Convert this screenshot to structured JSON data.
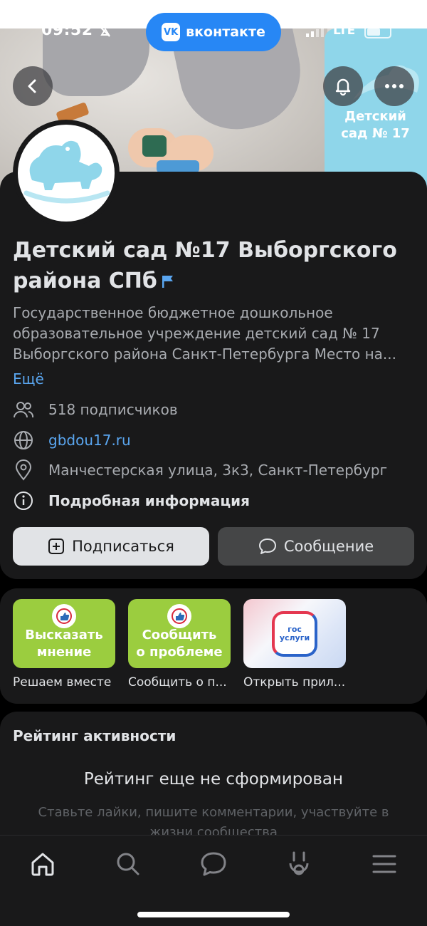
{
  "status_bar": {
    "time": "09:52",
    "network": "LTE"
  },
  "vk_pill": {
    "logo": "VK",
    "label": "вконтакте"
  },
  "cover": {
    "block_text_line1": "Детский",
    "block_text_line2": "сад № 17"
  },
  "header_buttons": {
    "back_icon": "chevron-left-icon",
    "bell_icon": "bell-icon",
    "more_icon": "more-dots-icon"
  },
  "community": {
    "title": "Детский сад №17 Выборгского района СПб",
    "description": "Государственное бюджетное дошкольное образовательное учреждение детский сад № 17 Выборгского района Санкт-Петербурга Место на...",
    "more_label": "Ещё",
    "subscribers": "518 подписчиков",
    "website": "gbdou17.ru",
    "address": "Манчестерская улица, 3к3, Санкт-Петербург",
    "details": "Подробная информация"
  },
  "actions": {
    "subscribe": "Подписаться",
    "message": "Сообщение"
  },
  "apps": [
    {
      "tile_line1": "Высказать",
      "tile_line2": "мнение",
      "caption": "Решаем вместе"
    },
    {
      "tile_line1": "Сообщить",
      "tile_line2": "о проблеме",
      "caption": "Сообщить о п..."
    },
    {
      "tile_line1": "гос",
      "tile_line2": "услуги",
      "caption": "Открыть прил..."
    }
  ],
  "rating": {
    "title": "Рейтинг активности",
    "headline": "Рейтинг еще не сформирован",
    "subtitle": "Ставьте лайки, пишите комментарии, участвуйте в жизни сообщества"
  },
  "tabbar": [
    "home-icon",
    "search-icon",
    "messages-icon",
    "clips-icon",
    "menu-icon"
  ],
  "colors": {
    "accent": "#2787f5",
    "link": "#5aa6f0",
    "background": "#19191a",
    "green_tile": "#9bcd3f",
    "cover_block": "#8fd6ea"
  }
}
